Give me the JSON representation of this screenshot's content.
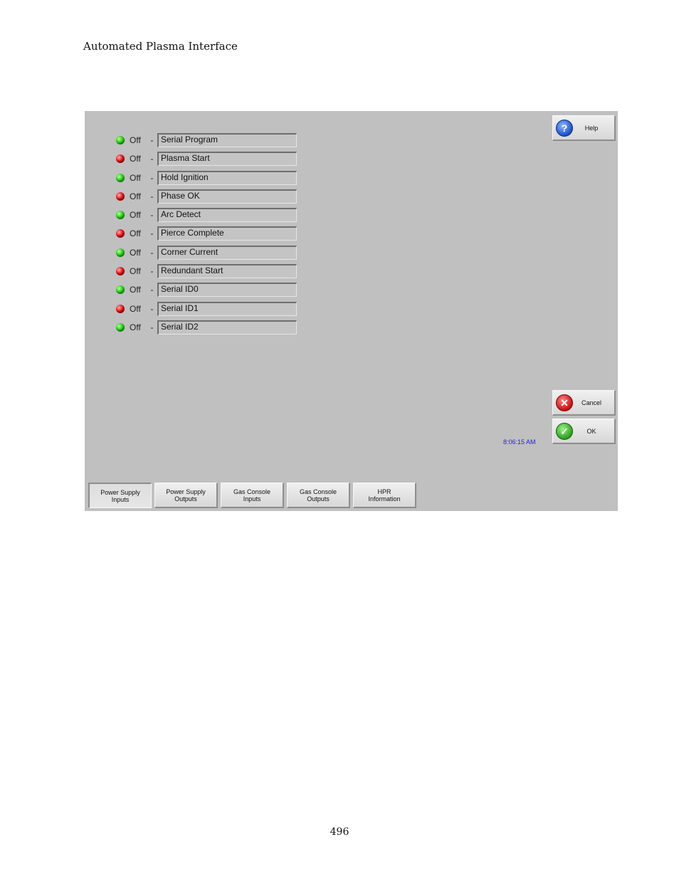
{
  "document": {
    "header": "Automated Plasma Interface",
    "page_number": "496"
  },
  "io_list": [
    {
      "led": "green",
      "state": "Off",
      "label": "Serial Program"
    },
    {
      "led": "red",
      "state": "Off",
      "label": "Plasma Start"
    },
    {
      "led": "green",
      "state": "Off",
      "label": "Hold Ignition"
    },
    {
      "led": "red",
      "state": "Off",
      "label": "Phase OK"
    },
    {
      "led": "green",
      "state": "Off",
      "label": "Arc Detect"
    },
    {
      "led": "red",
      "state": "Off",
      "label": "Pierce Complete"
    },
    {
      "led": "green",
      "state": "Off",
      "label": "Corner Current"
    },
    {
      "led": "red",
      "state": "Off",
      "label": "Redundant Start"
    },
    {
      "led": "green",
      "state": "Off",
      "label": "Serial ID0"
    },
    {
      "led": "red",
      "state": "Off",
      "label": "Serial ID1"
    },
    {
      "led": "green",
      "state": "Off",
      "label": "Serial ID2"
    }
  ],
  "separator": "-",
  "buttons": {
    "help": {
      "label": "Help",
      "icon": "question-icon",
      "glyph": "?"
    },
    "cancel": {
      "label": "Cancel",
      "icon": "x-icon",
      "glyph": "✕"
    },
    "ok": {
      "label": "OK",
      "icon": "check-icon",
      "glyph": "✓"
    }
  },
  "clock": "8:06:15 AM",
  "tabs": [
    {
      "line1": "Power Supply",
      "line2": "Inputs",
      "active": true
    },
    {
      "line1": "Power Supply",
      "line2": "Outputs",
      "active": false
    },
    {
      "line1": "Gas Console",
      "line2": "Inputs",
      "active": false
    },
    {
      "line1": "Gas Console",
      "line2": "Outputs",
      "active": false
    },
    {
      "line1": "HPR",
      "line2": "Information",
      "active": false
    }
  ],
  "colors": {
    "screen_bg": "#c0c0c0",
    "led_green": "#29d11a",
    "led_red": "#e8151a",
    "clock_text": "#2323e0"
  }
}
